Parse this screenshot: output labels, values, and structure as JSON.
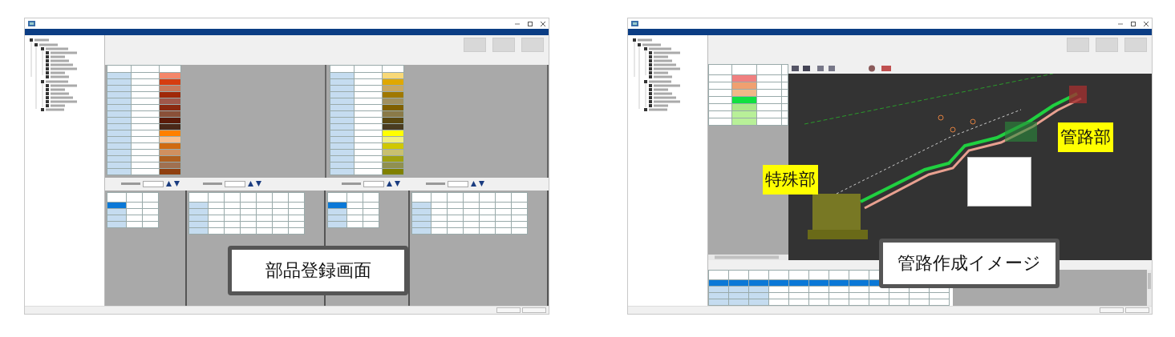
{
  "screens": [
    {
      "kind": "parts_registration",
      "caption": "部品登録画面",
      "swatch_tables": [
        {
          "swatches": [
            {
              "color": "#f4876a"
            },
            {
              "color": "#d63c10"
            },
            {
              "color": "#c8785a"
            },
            {
              "color": "#a02808"
            },
            {
              "color": "#a0584a"
            },
            {
              "color": "#8a2a10"
            },
            {
              "color": "#8a5038"
            },
            {
              "color": "#5a1a08"
            },
            {
              "color": "#4a2818"
            },
            {
              "color": "#ff8000"
            },
            {
              "color": "#f8c090"
            },
            {
              "color": "#d06a10"
            },
            {
              "color": "#d09060"
            },
            {
              "color": "#b06020"
            },
            {
              "color": "#a07050"
            },
            {
              "color": "#904010"
            }
          ]
        },
        {
          "swatches": [
            {
              "color": "#f8d878"
            },
            {
              "color": "#e0a800"
            },
            {
              "color": "#c8a860"
            },
            {
              "color": "#a07800"
            },
            {
              "color": "#a09060"
            },
            {
              "color": "#806000"
            },
            {
              "color": "#8a7a48"
            },
            {
              "color": "#5a4810"
            },
            {
              "color": "#4a3c20"
            },
            {
              "color": "#ffff00"
            },
            {
              "color": "#f0f080"
            },
            {
              "color": "#d0c800"
            },
            {
              "color": "#c8c070"
            },
            {
              "color": "#a0a010"
            },
            {
              "color": "#909050"
            },
            {
              "color": "#808000"
            }
          ]
        }
      ],
      "detail_tables": [
        {
          "kind": "narrow",
          "rows": [
            {
              "selected": true
            },
            {
              "selected": false
            },
            {
              "selected": false
            },
            {
              "selected": false
            }
          ]
        },
        {
          "kind": "wide",
          "rows": [
            {
              "selected": false
            },
            {
              "selected": false
            },
            {
              "selected": false
            },
            {
              "selected": false
            },
            {
              "selected": false
            }
          ]
        },
        {
          "kind": "narrow",
          "rows": [
            {
              "selected": true
            },
            {
              "selected": false
            },
            {
              "selected": false
            },
            {
              "selected": false
            }
          ]
        },
        {
          "kind": "wide",
          "rows": [
            {
              "selected": false
            },
            {
              "selected": false
            },
            {
              "selected": false
            },
            {
              "selected": false
            },
            {
              "selected": false
            }
          ]
        }
      ]
    },
    {
      "kind": "pipeline_creation",
      "caption": "管路作成イメージ",
      "part_rows": [
        {
          "color": "#f08080"
        },
        {
          "color": "#f0a070"
        },
        {
          "color": "#f0b888"
        },
        {
          "color": "#10e040"
        },
        {
          "color": "#a8e888"
        },
        {
          "color": "#b8f098"
        },
        {
          "color": "#b8f098"
        }
      ],
      "view_labels": [
        {
          "text": "特殊部"
        },
        {
          "text": "管路部"
        }
      ],
      "segment_rows": [
        {
          "selected": true
        },
        {
          "selected": false
        },
        {
          "selected": false
        },
        {
          "selected": false
        }
      ]
    }
  ]
}
